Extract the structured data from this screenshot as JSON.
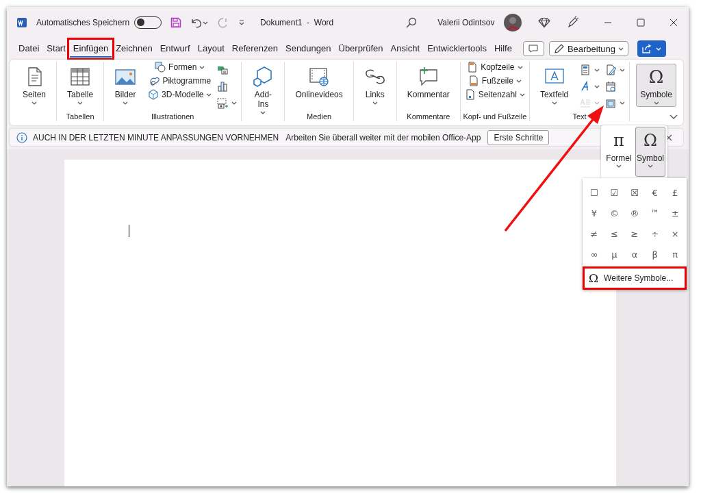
{
  "title_bar": {
    "autosave_label": "Automatisches Speichern",
    "autosave_on": false,
    "title": "Dokument1  -  Word",
    "user": "Valerii Odintsov"
  },
  "tabs": [
    {
      "label": "Datei",
      "selected": false,
      "highlighted": false
    },
    {
      "label": "Start",
      "selected": false,
      "highlighted": false
    },
    {
      "label": "Einfügen",
      "selected": true,
      "highlighted": true
    },
    {
      "label": "Zeichnen",
      "selected": false,
      "highlighted": false
    },
    {
      "label": "Entwurf",
      "selected": false,
      "highlighted": false
    },
    {
      "label": "Layout",
      "selected": false,
      "highlighted": false
    },
    {
      "label": "Referenzen",
      "selected": false,
      "highlighted": false
    },
    {
      "label": "Sendungen",
      "selected": false,
      "highlighted": false
    },
    {
      "label": "Überprüfen",
      "selected": false,
      "highlighted": false
    },
    {
      "label": "Ansicht",
      "selected": false,
      "highlighted": false
    },
    {
      "label": "Entwicklertools",
      "selected": false,
      "highlighted": false
    },
    {
      "label": "Hilfe",
      "selected": false,
      "highlighted": false
    }
  ],
  "editing_mode": "Bearbeitung",
  "ribbon": {
    "groups": [
      {
        "items": [
          {
            "kind": "large",
            "label": "Seiten",
            "dropdown": true
          }
        ]
      },
      {
        "label": "Tabellen",
        "items": [
          {
            "kind": "large",
            "label": "Tabelle",
            "dropdown": true
          }
        ]
      },
      {
        "label": "Illustrationen",
        "items": [
          {
            "kind": "large",
            "label": "Bilder",
            "dropdown": true
          },
          {
            "kind": "small",
            "label": "Formen",
            "dropdown": true
          },
          {
            "kind": "small",
            "label": "Piktogramme",
            "dropdown": false
          },
          {
            "kind": "small",
            "label": "3D-Modelle",
            "dropdown": true
          },
          {
            "kind": "icon",
            "dropdown": false
          },
          {
            "kind": "icon",
            "dropdown": false
          },
          {
            "kind": "icon",
            "dropdown": true
          }
        ]
      },
      {
        "items": [
          {
            "kind": "large",
            "label": "Add-Ins",
            "dropdown": true
          }
        ]
      },
      {
        "label": "Medien",
        "items": [
          {
            "kind": "large",
            "label": "Onlinevideos",
            "dropdown": false
          }
        ]
      },
      {
        "items": [
          {
            "kind": "large",
            "label": "Links",
            "dropdown": true
          }
        ]
      },
      {
        "label": "Kommentare",
        "items": [
          {
            "kind": "large",
            "label": "Kommentar",
            "dropdown": false
          }
        ]
      },
      {
        "label": "Kopf- und Fußzeile",
        "items": [
          {
            "kind": "small",
            "label": "Kopfzeile",
            "dropdown": true
          },
          {
            "kind": "small",
            "label": "Fußzeile",
            "dropdown": true
          },
          {
            "kind": "small",
            "label": "Seitenzahl",
            "dropdown": true
          }
        ]
      },
      {
        "label": "Text",
        "items": [
          {
            "kind": "large",
            "label": "Textfeld",
            "dropdown": true,
            "disabled": false
          },
          {
            "kind": "icon",
            "dropdown": true,
            "disabled": false
          },
          {
            "kind": "icon",
            "dropdown": true,
            "disabled": false
          },
          {
            "kind": "icon",
            "dropdown": true,
            "disabled": true
          },
          {
            "kind": "icon",
            "dropdown": true,
            "disabled": false
          },
          {
            "kind": "icon",
            "dropdown": false,
            "disabled": false
          },
          {
            "kind": "icon",
            "dropdown": true,
            "disabled": false
          }
        ]
      },
      {
        "items": [
          {
            "kind": "large",
            "label": "Symbole",
            "glyph": "Ω",
            "dropdown": true,
            "expanded": true
          }
        ]
      }
    ]
  },
  "info_bar": {
    "title": "AUCH IN DER LETZTEN MINUTE ANPASSUNGEN VORNEHMEN",
    "message": "Arbeiten Sie überall weiter mit der mobilen Office-App",
    "button": "Erste Schritte"
  },
  "symbols_menu": {
    "buttons": [
      {
        "label": "Formel",
        "glyph": "π",
        "selected": false
      },
      {
        "label": "Symbol",
        "glyph": "Ω",
        "selected": true
      }
    ],
    "symbols": [
      "☐",
      "☑",
      "☒",
      "€",
      "£",
      "¥",
      "©",
      "®",
      "™",
      "±",
      "≠",
      "≤",
      "≥",
      "÷",
      "×",
      "∞",
      "µ",
      "α",
      "β",
      "π"
    ],
    "more": {
      "glyph": "Ω",
      "label": "Weitere Symbole...",
      "highlighted": true
    }
  },
  "pointer_arrow": true
}
